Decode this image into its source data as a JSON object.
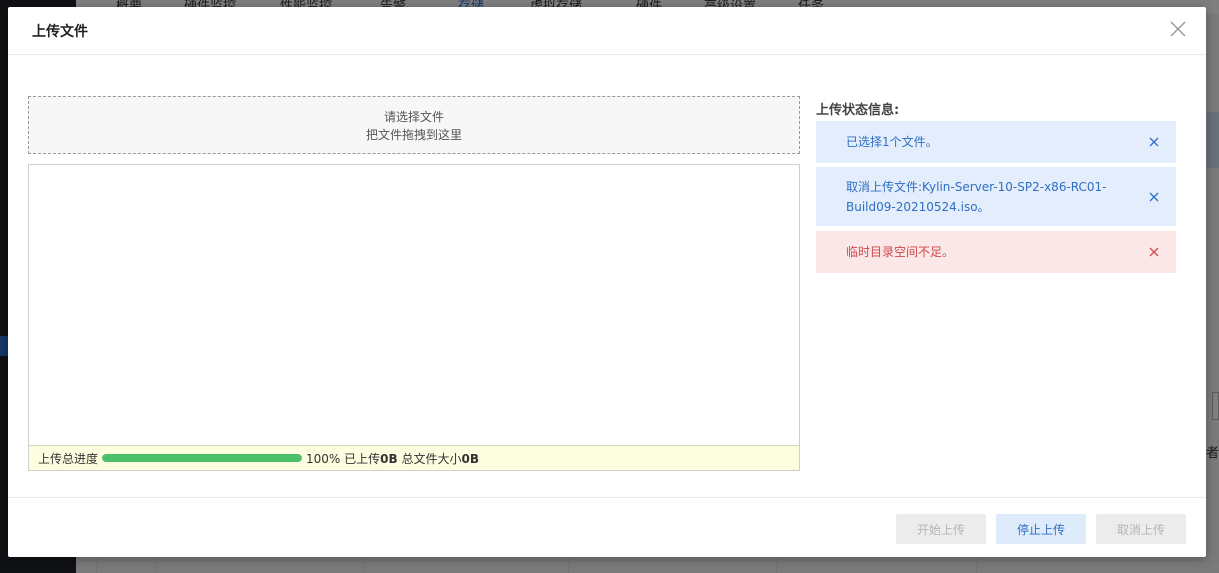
{
  "background": {
    "nav_items": [
      "概要",
      "硬件监控",
      "性能监控",
      "告警",
      "存储",
      "虚拟存储",
      "硬件",
      "高级设置",
      "任务"
    ],
    "side_text": "者"
  },
  "dialog": {
    "title": "上传文件",
    "close_icon": "close-icon",
    "dropzone": {
      "line1": "请选择文件",
      "line2": "把文件拖拽到这里"
    },
    "progress": {
      "label": "上传总进度",
      "percent": 100,
      "percent_text": "100%",
      "uploaded_label": "已上传",
      "uploaded_value": "0B",
      "total_label": "总文件大小",
      "total_value": "0B"
    },
    "status": {
      "title": "上传状态信息:",
      "messages": [
        {
          "type": "info",
          "text": "已选择1个文件。"
        },
        {
          "type": "info",
          "text": "取消上传文件:Kylin-Server-10-SP2-x86-RC01-Build09-20210524.iso。"
        },
        {
          "type": "error",
          "text": "临时目录空间不足。"
        }
      ]
    },
    "buttons": {
      "start": "开始上传",
      "stop": "停止上传",
      "cancel": "取消上传"
    }
  },
  "colors": {
    "info_bg": "#e3edfb",
    "info_text": "#2f6fc4",
    "error_bg": "#fbe7e7",
    "error_text": "#d04a4a",
    "progress_fill": "#4cbf6a"
  }
}
